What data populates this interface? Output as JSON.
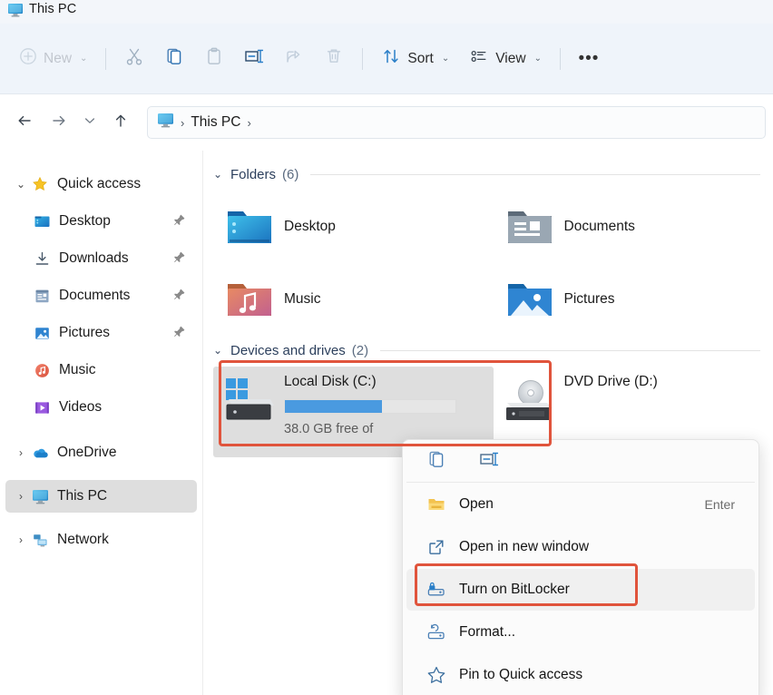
{
  "window": {
    "title": "This PC",
    "title_icon": "this-pc-monitor-icon"
  },
  "toolbar": {
    "new_label": "New",
    "new_icon": "plus-circle-icon",
    "cut_icon": "scissors-icon",
    "copy_icon": "copy-icon",
    "paste_icon": "clipboard-paste-icon",
    "rename_icon": "rename-icon",
    "share_icon": "share-icon",
    "delete_icon": "trash-icon",
    "sort_label": "Sort",
    "sort_icon": "sort-arrows-icon",
    "view_label": "View",
    "view_icon": "view-list-icon",
    "more_label": "•••",
    "chevron": "⌄"
  },
  "nav": {
    "back_icon": "arrow-left-icon",
    "forward_icon": "arrow-right-icon",
    "recent_icon": "chevron-down-icon",
    "up_icon": "arrow-up-icon",
    "breadcrumb": {
      "icon": "this-pc-monitor-icon",
      "separator": "›",
      "path": "This PC"
    }
  },
  "sidebar": {
    "groups": [
      {
        "label": "Quick access",
        "icon": "star-icon",
        "twisty": "⌄",
        "expanded": true,
        "selected": false,
        "children": [
          {
            "label": "Desktop",
            "icon": "desktop-folder-icon",
            "pinned": true
          },
          {
            "label": "Downloads",
            "icon": "downloads-icon",
            "pinned": true
          },
          {
            "label": "Documents",
            "icon": "documents-folder-icon",
            "pinned": true
          },
          {
            "label": "Pictures",
            "icon": "pictures-folder-icon",
            "pinned": true
          },
          {
            "label": "Music",
            "icon": "music-circle-icon",
            "pinned": false
          },
          {
            "label": "Videos",
            "icon": "videos-icon",
            "pinned": false
          }
        ]
      },
      {
        "label": "OneDrive",
        "icon": "onedrive-cloud-icon",
        "twisty": "›",
        "expanded": false,
        "selected": false,
        "children": []
      },
      {
        "label": "This PC",
        "icon": "this-pc-monitor-icon",
        "twisty": "›",
        "expanded": false,
        "selected": true,
        "children": []
      },
      {
        "label": "Network",
        "icon": "network-icon",
        "twisty": "›",
        "expanded": false,
        "selected": false,
        "children": []
      }
    ],
    "pin_icon": "pin-icon"
  },
  "content": {
    "folders_group": {
      "chevron": "⌄",
      "title": "Folders",
      "count": "(6)",
      "items": [
        {
          "name": "Desktop",
          "icon": "desktop-folder-icon"
        },
        {
          "name": "Documents",
          "icon": "documents-folder-icon"
        },
        {
          "name": "Music",
          "icon": "music-folder-icon"
        },
        {
          "name": "Pictures",
          "icon": "pictures-folder-icon"
        }
      ]
    },
    "drives_group": {
      "chevron": "⌄",
      "title": "Devices and drives",
      "count": "(2)",
      "items": [
        {
          "name": "Local Disk (C:)",
          "icon": "hard-drive-windows-icon",
          "selected": true,
          "free_text": "38.0 GB free of",
          "usage_percent": 57
        },
        {
          "name": "DVD Drive (D:)",
          "icon": "dvd-drive-icon",
          "selected": false,
          "free_text": "",
          "usage_percent": 0
        }
      ]
    }
  },
  "context_menu": {
    "commands": [
      {
        "icon": "copy-icon",
        "name": "copy"
      },
      {
        "icon": "rename-icon",
        "name": "rename"
      }
    ],
    "items": [
      {
        "label": "Open",
        "icon": "folder-open-icon",
        "accel": "Enter",
        "hover": false
      },
      {
        "label": "Open in new window",
        "icon": "new-window-icon",
        "accel": "",
        "hover": false
      },
      {
        "label": "Turn on BitLocker",
        "icon": "bitlocker-lock-icon",
        "accel": "",
        "hover": true
      },
      {
        "label": "Format...",
        "icon": "format-drive-icon",
        "accel": "",
        "hover": false
      },
      {
        "label": "Pin to Quick access",
        "icon": "star-outline-icon",
        "accel": "",
        "hover": false
      }
    ]
  },
  "annotations": {
    "color": "#e0543c",
    "boxes": [
      {
        "name": "local-disk-highlight"
      },
      {
        "name": "turn-on-bitlocker-highlight"
      }
    ]
  }
}
